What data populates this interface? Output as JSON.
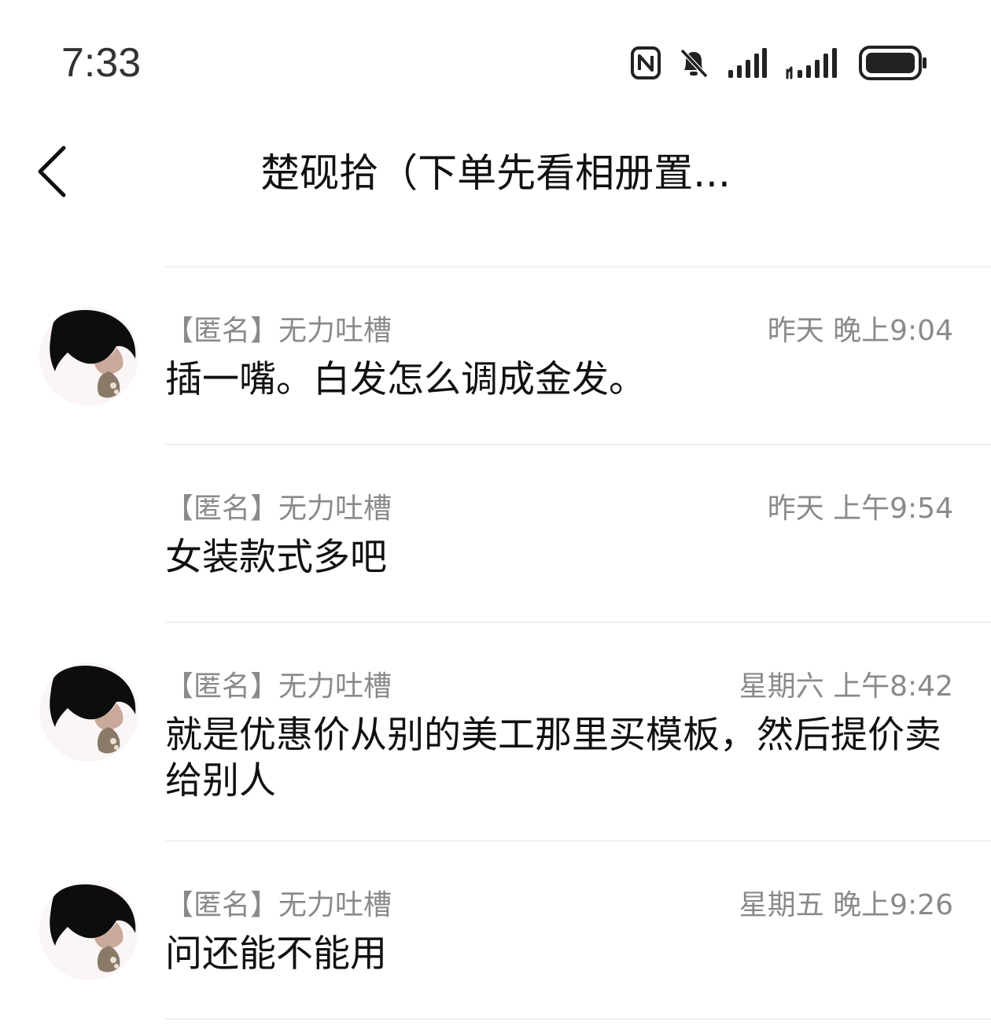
{
  "status_bar": {
    "time": "7:33",
    "icons": [
      "nfc-icon",
      "bell-muted-icon",
      "signal-icon",
      "signal-icon",
      "battery-icon"
    ]
  },
  "header": {
    "title": "楚砚拾（下单先看相册置..."
  },
  "messages": [
    {
      "sender": "【匿名】无力吐槽",
      "time": "昨天 晚上9:04",
      "text": "插一嘴。白发怎么调成金发。",
      "show_avatar": true
    },
    {
      "sender": "【匿名】无力吐槽",
      "time": "昨天 上午9:54",
      "text": "女装款式多吧",
      "show_avatar": false
    },
    {
      "sender": "【匿名】无力吐槽",
      "time": "星期六 上午8:42",
      "text": "就是优惠价从别的美工那里买模板，然后提价卖给别人",
      "show_avatar": true
    },
    {
      "sender": "【匿名】无力吐槽",
      "time": "星期五 晚上9:26",
      "text": "问还能不能用",
      "show_avatar": true
    }
  ]
}
